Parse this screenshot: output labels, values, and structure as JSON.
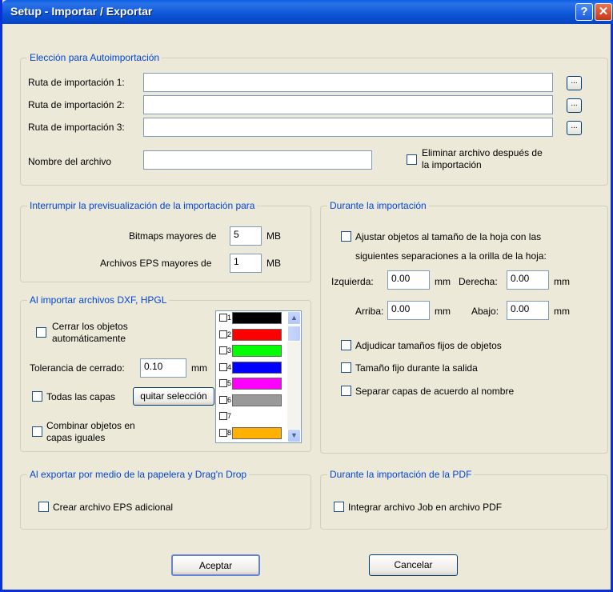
{
  "window": {
    "title": "Setup - Importar / Exportar",
    "help_label": "?",
    "close_label": "✕"
  },
  "autoimport": {
    "legend": "Elección para Autoimportación",
    "path1_label": "Ruta de importación 1:",
    "path2_label": "Ruta de importación 2:",
    "path3_label": "Ruta de importación 3:",
    "path1_value": "",
    "path2_value": "",
    "path3_value": "",
    "browse_label": "...",
    "filename_label": "Nombre del archivo",
    "filename_value": "",
    "delete_after_label_1": "Eliminar archivo después de",
    "delete_after_label_2": "la importación",
    "delete_after_checked": false
  },
  "preview": {
    "legend": "Interrumpir la previsualización de la importación para",
    "bitmaps_label": "Bitmaps mayores de",
    "bitmaps_value": "5",
    "eps_label": "Archivos EPS mayores de",
    "eps_value": "1",
    "unit": "MB"
  },
  "during_import": {
    "legend": "Durante la importación",
    "fit_label_1": "Ajustar objetos al tamaño de la hoja con las",
    "fit_label_2": "siguientes separaciones a la orilla de la hoja:",
    "left_label": "Izquierda:",
    "left_value": "0.00",
    "right_label": "Derecha:",
    "right_value": "0.00",
    "top_label": "Arriba:",
    "top_value": "0.00",
    "bottom_label": "Abajo:",
    "bottom_value": "0.00",
    "unit": "mm",
    "fixed_sizes_label": "Adjudicar tamaños fijos de objetos",
    "fixed_output_label": "Tamaño fijo durante la salida",
    "separate_layers_label": "Separar capas de acuerdo al nombre"
  },
  "dxf": {
    "legend": "Al importar archivos DXF, HPGL",
    "close_objects_label_1": "Cerrar los objetos",
    "close_objects_label_2": "automáticamente",
    "tolerance_label": "Tolerancia de cerrado:",
    "tolerance_value": "0.10",
    "tolerance_unit": "mm",
    "all_layers_label": "Todas las capas",
    "remove_selection_label": "quitar selección",
    "combine_label_1": "Combinar objetos en",
    "combine_label_2": "capas iguales",
    "layers": [
      {
        "num": "1",
        "color": "#000000"
      },
      {
        "num": "2",
        "color": "#ff0000"
      },
      {
        "num": "3",
        "color": "#00ff00"
      },
      {
        "num": "4",
        "color": "#0000ff"
      },
      {
        "num": "5",
        "color": "#ff00ff"
      },
      {
        "num": "6",
        "color": "#999999"
      },
      {
        "num": "7",
        "color": "#ffffff"
      },
      {
        "num": "8",
        "color": "#ffb000"
      }
    ]
  },
  "export": {
    "legend": "Al exportar por medio de la papelera y Drag'n Drop",
    "eps_label": "Crear archivo EPS adicional"
  },
  "pdf": {
    "legend": "Durante la importación de la PDF",
    "integrate_label": "Integrar archivo Job en archivo PDF"
  },
  "buttons": {
    "ok_label": "Aceptar",
    "cancel_label": "Cancelar"
  }
}
